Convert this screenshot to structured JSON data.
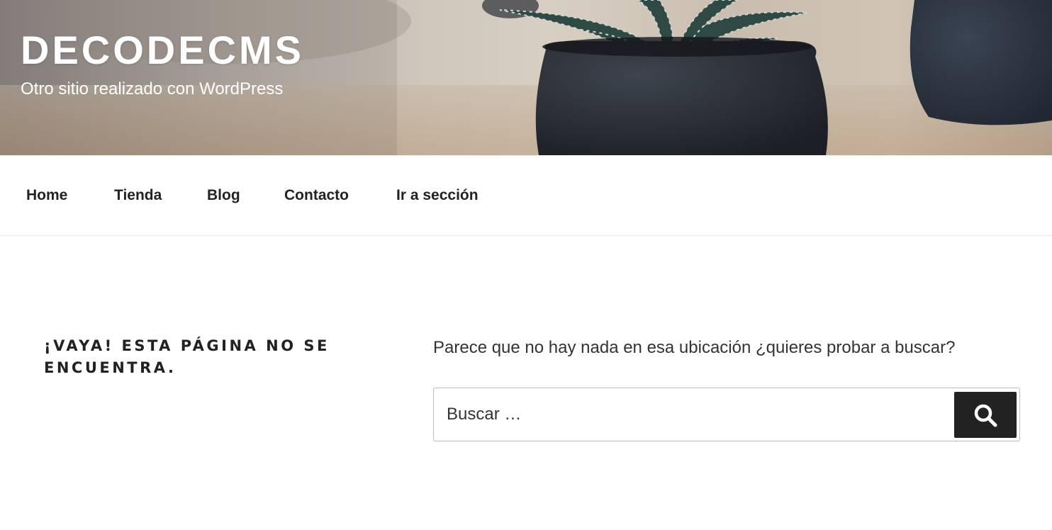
{
  "header": {
    "site_title": "DECODECMS",
    "site_description": "Otro sitio realizado con WordPress"
  },
  "nav": {
    "items": [
      {
        "label": "Home"
      },
      {
        "label": "Tienda"
      },
      {
        "label": "Blog"
      },
      {
        "label": "Contacto"
      },
      {
        "label": "Ir a sección"
      }
    ]
  },
  "main": {
    "title": "¡Vaya! Esta página no se encuentra.",
    "message": "Parece que no hay nada en esa ubicación ¿quieres probar a buscar?",
    "search": {
      "placeholder": "Buscar …",
      "button_icon": "search-icon"
    }
  },
  "colors": {
    "text": "#222222",
    "button_bg": "#222222",
    "header_text": "#ffffff"
  }
}
